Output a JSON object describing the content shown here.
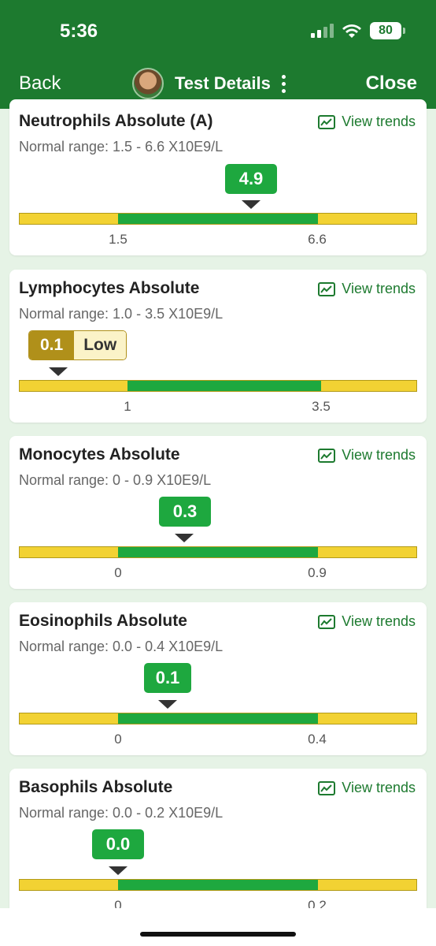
{
  "status": {
    "time": "5:36",
    "battery": "80"
  },
  "nav": {
    "back": "Back",
    "title": "Test Details",
    "close": "Close"
  },
  "trends_label": "View trends",
  "tests": [
    {
      "name": "Neutrophils Absolute (A)",
      "range": "Normal range: 1.5 - 6.6 X10E9/L",
      "value": "4.9",
      "low": "1.5",
      "high": "6.6",
      "flag": ""
    },
    {
      "name": "Lymphocytes Absolute",
      "range": "Normal range: 1.0 - 3.5 X10E9/L",
      "value": "0.1",
      "low": "1",
      "high": "3.5",
      "flag": "Low"
    },
    {
      "name": "Monocytes Absolute",
      "range": "Normal range: 0 - 0.9 X10E9/L",
      "value": "0.3",
      "low": "0",
      "high": "0.9",
      "flag": ""
    },
    {
      "name": "Eosinophils Absolute",
      "range": "Normal range: 0.0 - 0.4 X10E9/L",
      "value": "0.1",
      "low": "0",
      "high": "0.4",
      "flag": ""
    },
    {
      "name": "Basophils Absolute",
      "range": "Normal range: 0.0 - 0.2 X10E9/L",
      "value": "0.0",
      "low": "0",
      "high": "0.2",
      "flag": ""
    }
  ],
  "colors": {
    "header": "#1d7a2f",
    "normal": "#1ea83f",
    "out_of_range": "#f2d233",
    "low_flag": "#b0901a"
  }
}
